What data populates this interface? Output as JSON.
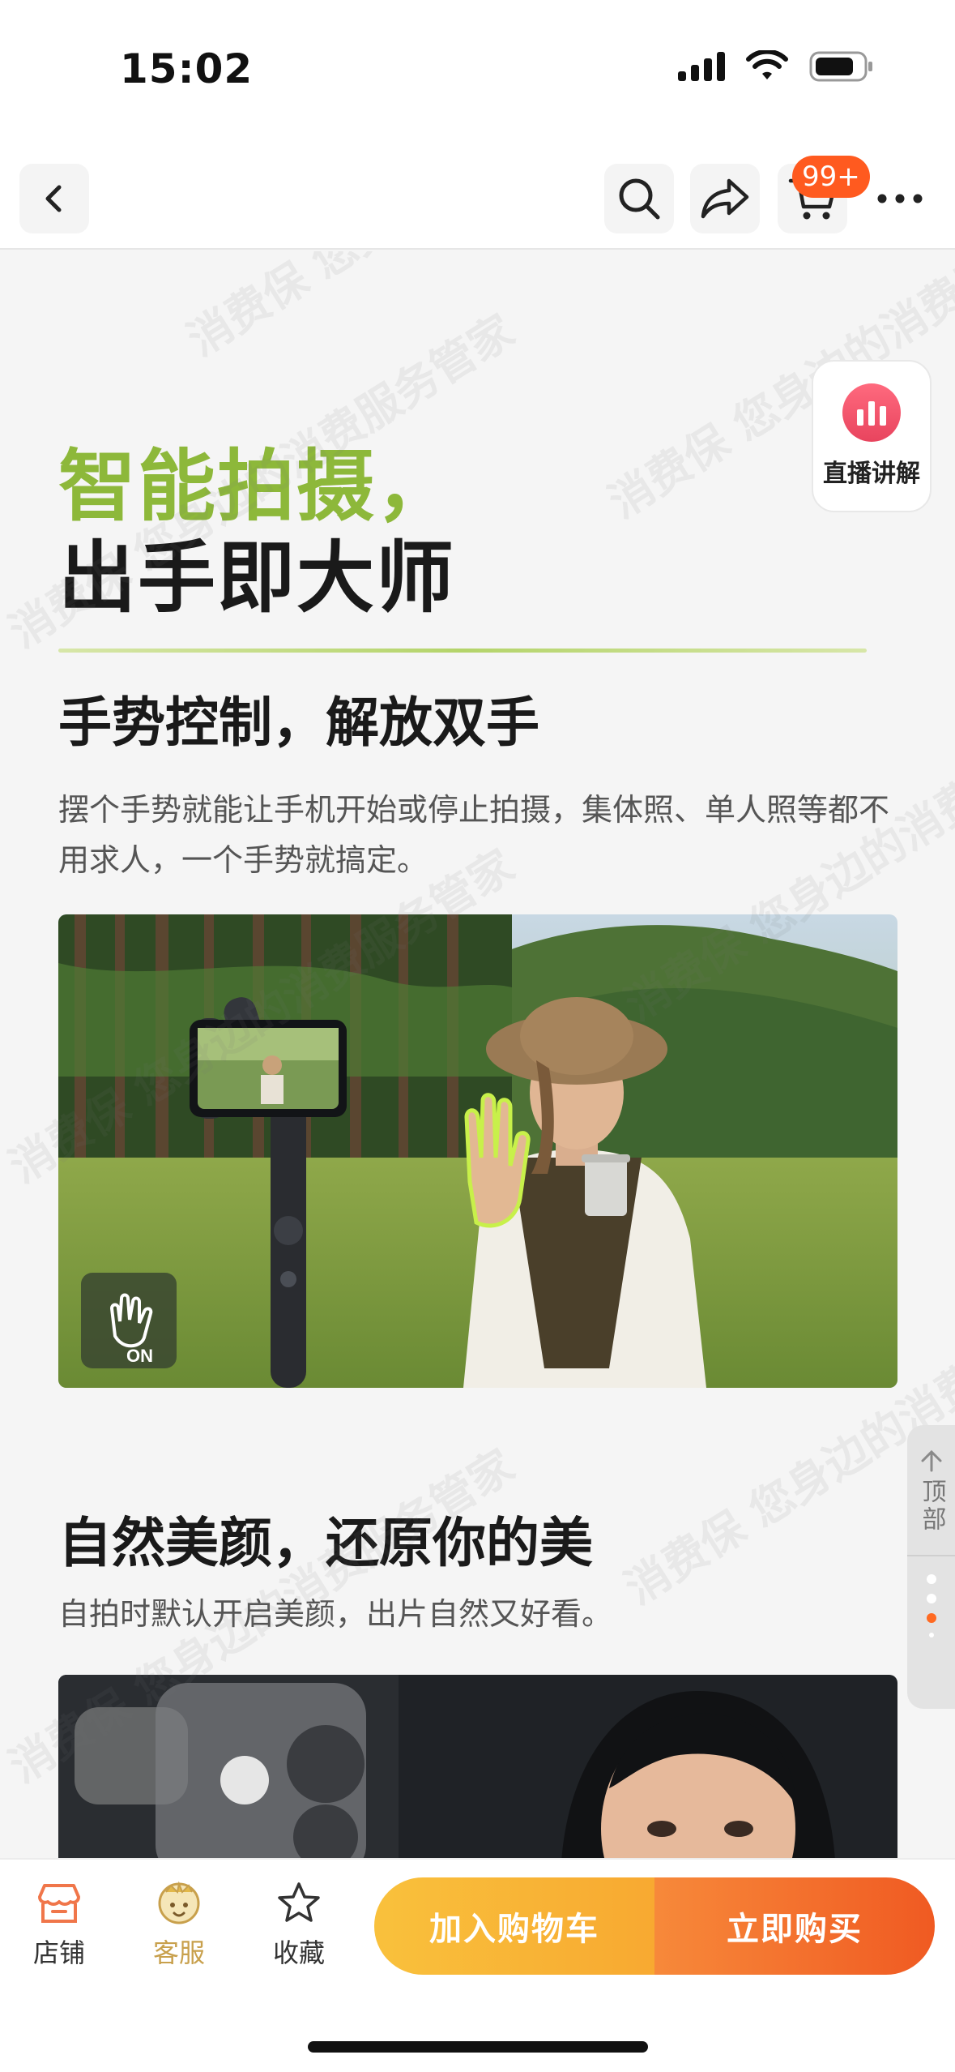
{
  "status": {
    "time": "15:02"
  },
  "nav": {
    "cart_badge": "99+"
  },
  "live": {
    "label": "直播讲解"
  },
  "hero": {
    "line1": "智能拍摄，",
    "line2": "出手即大师"
  },
  "sections": [
    {
      "title": "手势控制，解放双手",
      "desc": "摆个手势就能让手机开始或停止拍摄，集体照、单人照等都不用求人，一个手势就搞定。",
      "badge": "ON"
    },
    {
      "title": "自然美颜，还原你的美",
      "desc": "自拍时默认开启美颜，出片自然又好看。"
    }
  ],
  "side_nav": {
    "top_label": "顶部"
  },
  "bottom_bar": {
    "shop": "店铺",
    "service": "客服",
    "favorite": "收藏",
    "add_to_cart": "加入购物车",
    "buy_now": "立即购买"
  },
  "watermark": {
    "text": "消费保  您身边的消费服务管家"
  },
  "colors": {
    "accent_green": "#8db83a",
    "cta_orange": "#f05a22",
    "cta_yellow": "#f9c13c",
    "badge": "#ff5a1f",
    "service_gold": "#c8a04c"
  }
}
